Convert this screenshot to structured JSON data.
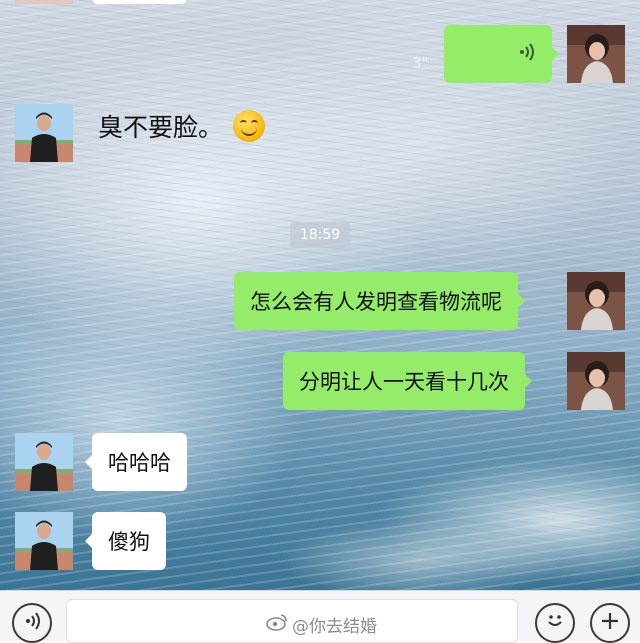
{
  "messages": {
    "voice": {
      "duration": "3\""
    },
    "plain_text": "臭不要脸。",
    "timestamp": "18:59",
    "sent_1": "怎么会有人发明查看物流呢",
    "sent_2": "分明让人一天看十几次",
    "received_1": "哈哈哈",
    "received_2": "傻狗"
  },
  "watermark": {
    "text": "@你去结婚"
  },
  "colors": {
    "sent_bubble": "#95ec69",
    "received_bubble": "#ffffff"
  },
  "icons": {
    "voice_bubble": "voice-wave-icon",
    "emoji": "smiley-emoji-icon",
    "voice_toggle": "voice-toggle-icon",
    "emoji_button": "emoji-icon",
    "more_button": "plus-icon",
    "watermark": "weibo-logo-icon"
  }
}
